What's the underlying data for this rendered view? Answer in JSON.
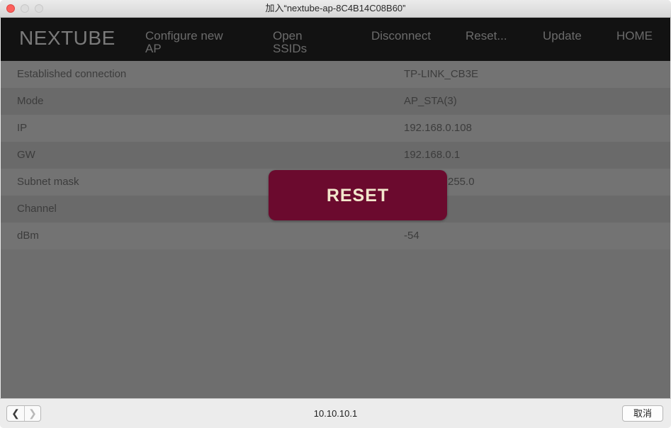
{
  "window": {
    "title": "加入“nextube-ap-8C4B14C08B60”"
  },
  "navbar": {
    "brand": "NEXTUBE",
    "items": [
      {
        "line1": "Configure new",
        "line2": "AP"
      },
      {
        "line1": "Open",
        "line2": "SSIDs"
      },
      {
        "line1": "Disconnect"
      },
      {
        "line1": "Reset..."
      },
      {
        "line1": "Update"
      },
      {
        "line1": "HOME"
      }
    ]
  },
  "status_table": {
    "rows": [
      {
        "label": "Established connection",
        "value": "TP-LINK_CB3E"
      },
      {
        "label": "Mode",
        "value": "AP_STA(3)"
      },
      {
        "label": "IP",
        "value": "192.168.0.108"
      },
      {
        "label": "GW",
        "value": "192.168.0.1"
      },
      {
        "label": "Subnet mask",
        "value": "255.0"
      },
      {
        "label": "Channel",
        "value": ""
      },
      {
        "label": "dBm",
        "value": "-54"
      }
    ]
  },
  "modal": {
    "label": "RESET",
    "color": "#6b0a2e"
  },
  "bottombar": {
    "back_icon": "chevron-left-icon",
    "forward_icon": "chevron-right-icon",
    "back_glyph": "❮",
    "forward_glyph": "❯",
    "url": "10.10.10.1",
    "cancel_label": "取消"
  }
}
